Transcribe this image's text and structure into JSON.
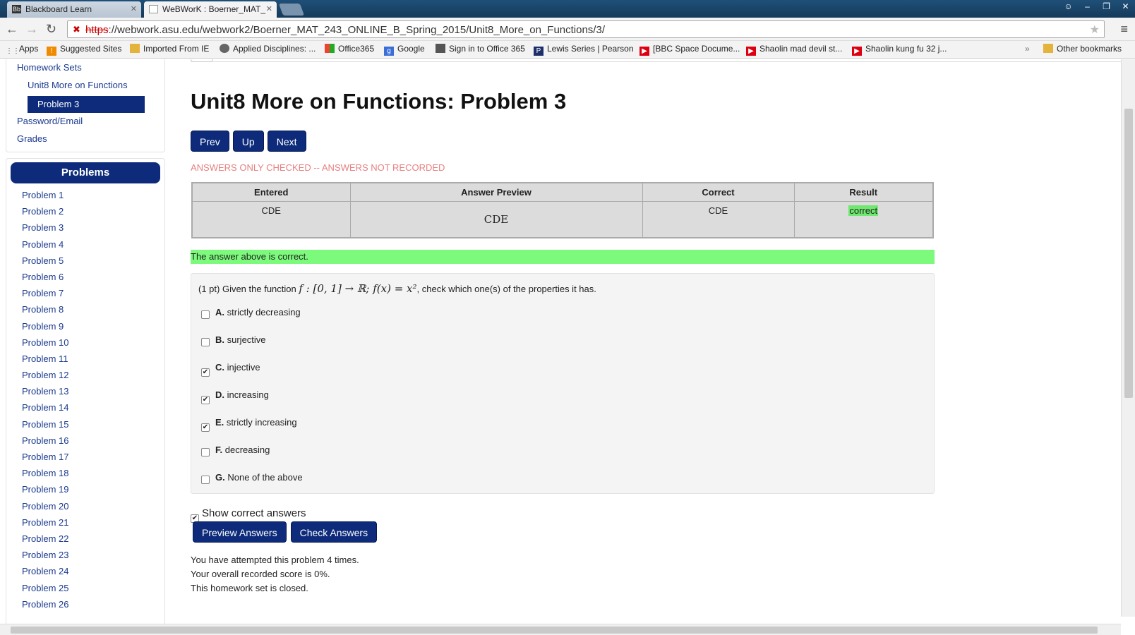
{
  "browser": {
    "tabs": [
      {
        "label": "Blackboard Learn",
        "icon": "Bb"
      },
      {
        "label": "WeBWorK : Boerner_MAT_",
        "icon": "page"
      }
    ],
    "url_scheme": "https",
    "url_rest": "://webwork.asu.edu/webwork2/Boerner_MAT_243_ONLINE_B_Spring_2015/Unit8_More_on_Functions/3/",
    "bookmarks": [
      {
        "label": "Apps"
      },
      {
        "label": "Suggested Sites"
      },
      {
        "label": "Imported From IE"
      },
      {
        "label": "Applied Disciplines: ..."
      },
      {
        "label": "Office365"
      },
      {
        "label": "Google"
      },
      {
        "label": "Sign in to Office 365"
      },
      {
        "label": "Lewis Series | Pearson"
      },
      {
        "label": "[BBC Space Docume..."
      },
      {
        "label": "Shaolin mad devil st..."
      },
      {
        "label": "Shaolin kung fu 32 j..."
      },
      {
        "label": "Other bookmarks"
      }
    ],
    "bookmarks_overflow": "»"
  },
  "sidebar": {
    "homework_sets": "Homework Sets",
    "set_name": "Unit8 More on Functions",
    "current_problem": "Problem 3",
    "password_email": "Password/Email",
    "grades": "Grades",
    "problems_heading": "Problems",
    "problems": [
      "Problem 1",
      "Problem 2",
      "Problem 3",
      "Problem 4",
      "Problem 5",
      "Problem 6",
      "Problem 7",
      "Problem 8",
      "Problem 9",
      "Problem 10",
      "Problem 11",
      "Problem 12",
      "Problem 13",
      "Problem 14",
      "Problem 15",
      "Problem 16",
      "Problem 17",
      "Problem 18",
      "Problem 19",
      "Problem 20",
      "Problem 21",
      "Problem 22",
      "Problem 23",
      "Problem 24",
      "Problem 25",
      "Problem 26"
    ]
  },
  "main": {
    "title": "Unit8 More on Functions: Problem 3",
    "nav": {
      "prev": "Prev",
      "up": "Up",
      "next": "Next"
    },
    "warning": "ANSWERS ONLY CHECKED -- ANSWERS NOT RECORDED",
    "results_table": {
      "headers": [
        "Entered",
        "Answer Preview",
        "Correct",
        "Result"
      ],
      "row": {
        "entered": "CDE",
        "preview": "CDE",
        "correct": "CDE",
        "result": "correct"
      }
    },
    "correct_message": "The answer above is correct.",
    "question_prefix": "(1 pt) Given the function ",
    "question_math": "f : [0, 1] → ℝ; f(x) = x²",
    "question_suffix": ", check which one(s) of the properties it has.",
    "options": [
      {
        "letter": "A.",
        "text": "strictly decreasing",
        "checked": false
      },
      {
        "letter": "B.",
        "text": "surjective",
        "checked": false
      },
      {
        "letter": "C.",
        "text": "injective",
        "checked": true
      },
      {
        "letter": "D.",
        "text": "increasing",
        "checked": true
      },
      {
        "letter": "E.",
        "text": "strictly increasing",
        "checked": true
      },
      {
        "letter": "F.",
        "text": "decreasing",
        "checked": false
      },
      {
        "letter": "G.",
        "text": "None of the above",
        "checked": false
      }
    ],
    "show_correct_answers": "Show correct answers",
    "show_correct_checked": true,
    "preview_answers": "Preview Answers",
    "check_answers": "Check Answers",
    "attempts": "You have attempted this problem 4 times.",
    "score": "Your overall recorded score is 0%.",
    "closed": "This homework set is closed."
  },
  "colors": {
    "nav_blue": "#0d2b7a",
    "correct_green": "#7cfa7c",
    "warning_pink": "#e88080"
  }
}
